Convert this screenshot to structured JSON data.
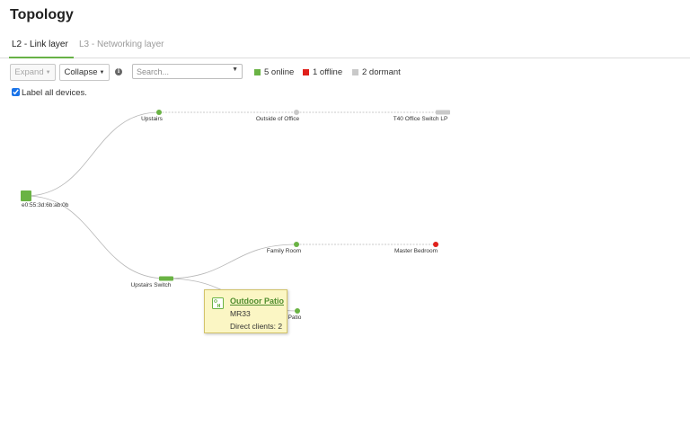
{
  "page": {
    "title": "Topology"
  },
  "tabs": [
    {
      "label": "L2 - Link layer",
      "active": true
    },
    {
      "label": "L3 - Networking layer",
      "active": false
    }
  ],
  "toolbar": {
    "expand_label": "Expand",
    "collapse_label": "Collapse",
    "search_placeholder": "Search...",
    "info_icon": "info-icon"
  },
  "legend": {
    "online": {
      "label": "5 online",
      "color": "#6ab344"
    },
    "offline": {
      "label": "1 offline",
      "color": "#e0201b"
    },
    "dormant": {
      "label": "2 dormant",
      "color": "#c9c9c9"
    }
  },
  "label_all": {
    "label": "Label all devices.",
    "checked": true
  },
  "topology": {
    "nodes": [
      {
        "id": "gateway",
        "label": "e0:55:3d:6b:ab:0b",
        "status": "online",
        "kind": "gateway"
      },
      {
        "id": "upstairs",
        "label": "Upstairs",
        "status": "online",
        "kind": "ap"
      },
      {
        "id": "outside",
        "label": "Outside of Office",
        "status": "dormant",
        "kind": "ap"
      },
      {
        "id": "t40",
        "label": "T40 Office Switch LP",
        "status": "dormant",
        "kind": "switch"
      },
      {
        "id": "upstairs_switch",
        "label": "Upstairs Switch",
        "status": "online",
        "kind": "switch"
      },
      {
        "id": "family_room",
        "label": "Family Room",
        "status": "online",
        "kind": "ap"
      },
      {
        "id": "master_bedroom",
        "label": "Master Bedroom",
        "status": "offline",
        "kind": "ap"
      },
      {
        "id": "patio",
        "label": "Patio",
        "status": "online",
        "kind": "ap"
      }
    ],
    "links": [
      {
        "from": "gateway",
        "to": "upstairs",
        "style": "solid"
      },
      {
        "from": "upstairs",
        "to": "outside",
        "style": "dashed"
      },
      {
        "from": "outside",
        "to": "t40",
        "style": "dashed"
      },
      {
        "from": "gateway",
        "to": "upstairs_switch",
        "style": "solid"
      },
      {
        "from": "upstairs_switch",
        "to": "family_room",
        "style": "solid"
      },
      {
        "from": "family_room",
        "to": "master_bedroom",
        "style": "dashed"
      },
      {
        "from": "upstairs_switch",
        "to": "patio",
        "style": "solid"
      }
    ]
  },
  "tooltip": {
    "name": "Outdoor Patio",
    "model": "MR33",
    "clients": "Direct clients: 2",
    "icon": "access-point-icon"
  }
}
